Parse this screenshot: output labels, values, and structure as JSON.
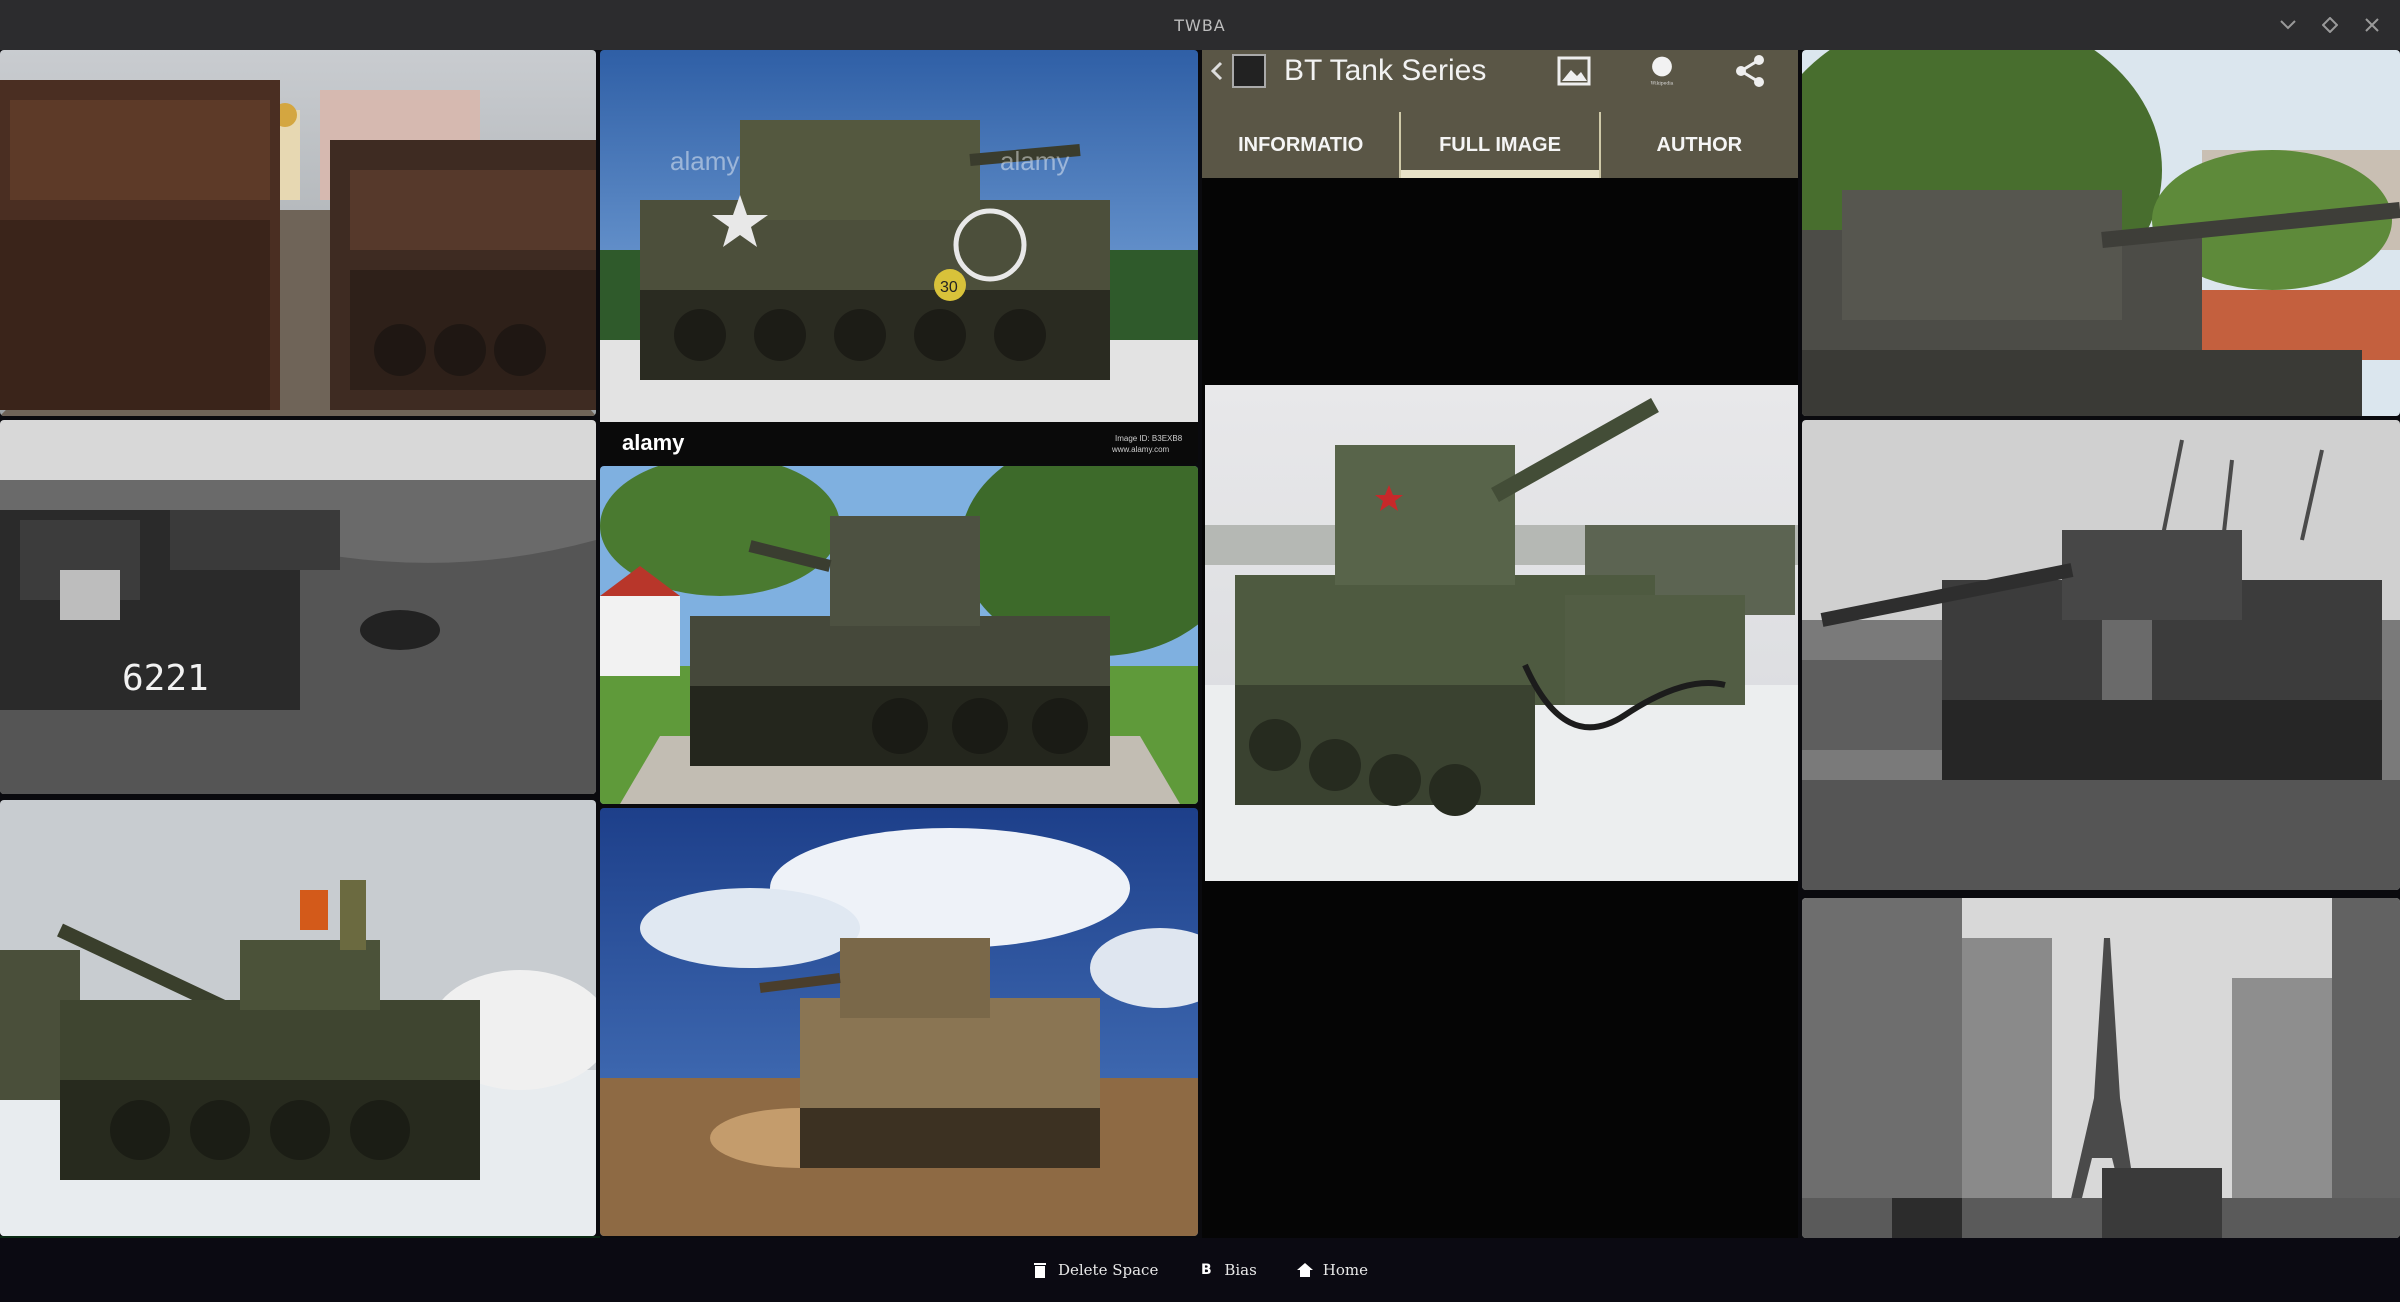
{
  "window": {
    "title": "TWBA",
    "controls": [
      "chevron-down",
      "restore",
      "close"
    ]
  },
  "gallery": {
    "tiles": [
      {
        "id": "t1",
        "subject": "destroyed-tanks-street"
      },
      {
        "id": "t2",
        "subject": "sherman-tank",
        "watermark": "alamy",
        "caption_left": "alamy",
        "caption_right_1": "Image ID: B3EXB8",
        "caption_right_2": "www.alamy.com"
      },
      {
        "id": "t3",
        "subject": "t34-tank-park"
      },
      {
        "id": "t4",
        "subject": "wrecked-tank-field"
      },
      {
        "id": "t5",
        "subject": "stuart-light-tank"
      },
      {
        "id": "t6",
        "subject": "panther-tank-ruins"
      },
      {
        "id": "t7",
        "subject": "t55-tank-snow"
      },
      {
        "id": "t8",
        "subject": "m3-lee-tank-desert"
      },
      {
        "id": "t9",
        "subject": "paris-eiffel-tank"
      }
    ],
    "t4_number": "6221",
    "t2_marking": "30"
  },
  "detail": {
    "title": "BT Tank Series",
    "tabs": [
      {
        "label": "INFORMATIO",
        "active": false
      },
      {
        "label": "FULL IMAGE",
        "active": true
      },
      {
        "label": "AUTHOR",
        "active": false
      }
    ],
    "icons": [
      "image-icon",
      "wikipedia-icon",
      "share-icon"
    ],
    "wiki_label": "Wikipedia"
  },
  "bottombar": {
    "items": [
      {
        "icon": "trash-icon",
        "label": "Delete Space"
      },
      {
        "icon": "B",
        "label": "Bias"
      },
      {
        "icon": "home-icon",
        "label": "Home"
      }
    ]
  },
  "colors": {
    "header": "#5a5646",
    "titlebar": "#2c2c2e",
    "background": "#0a0a0e",
    "accent": "#e8e2c8"
  }
}
